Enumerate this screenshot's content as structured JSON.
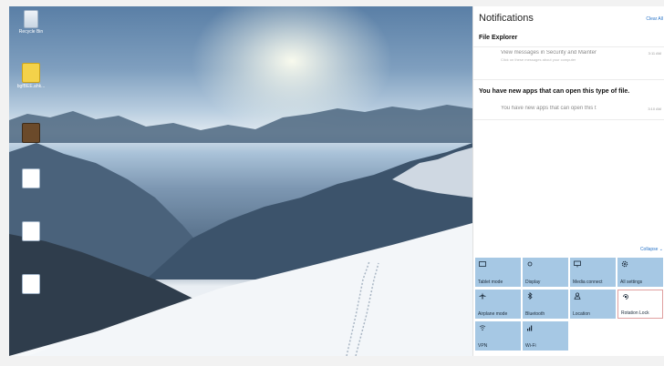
{
  "desktop": {
    "icons": [
      {
        "label": "Recycle Bin",
        "icon": "recycle-bin-icon"
      },
      {
        "label": "bgfBEE.ahk...",
        "icon": "script-file-icon"
      },
      {
        "label": "",
        "icon": "image-file-icon"
      },
      {
        "label": "",
        "icon": "document-icon"
      },
      {
        "label": "",
        "icon": "document-icon"
      },
      {
        "label": "",
        "icon": "document-icon"
      }
    ]
  },
  "notifications": {
    "title": "Notifications",
    "clear_all": "Clear All",
    "groups": [
      {
        "app": "File Explorer",
        "items": [
          {
            "title": "View messages in Security and Mainter",
            "subtitle": "Click on these messages about your computer",
            "time": "3:11 AM"
          }
        ]
      },
      {
        "app": "You have new apps that can open this type of file.",
        "items": [
          {
            "title": "You have new apps that can open this t",
            "subtitle": "",
            "time": "3:10 AM"
          }
        ]
      }
    ],
    "collapse": "Collapse"
  },
  "quick_actions": [
    {
      "label": "Tablet mode",
      "icon": "tablet-mode-icon",
      "active": true
    },
    {
      "label": "Display",
      "icon": "display-icon",
      "active": true
    },
    {
      "label": "Media connect",
      "icon": "media-connect-icon",
      "active": true
    },
    {
      "label": "All settings",
      "icon": "gear-icon",
      "active": true
    },
    {
      "label": "Airplane mode",
      "icon": "airplane-icon",
      "active": true
    },
    {
      "label": "Bluetooth",
      "icon": "bluetooth-icon",
      "active": true
    },
    {
      "label": "Location",
      "icon": "location-icon",
      "active": true
    },
    {
      "label": "Rotation Lock",
      "icon": "rotation-lock-icon",
      "active": false
    },
    {
      "label": "VPN",
      "icon": "vpn-icon",
      "active": true
    },
    {
      "label": "Wi-Fi",
      "icon": "wifi-icon",
      "active": true
    }
  ],
  "colors": {
    "tile_active": "#a6c8e4",
    "accent": "#2b76c9"
  }
}
